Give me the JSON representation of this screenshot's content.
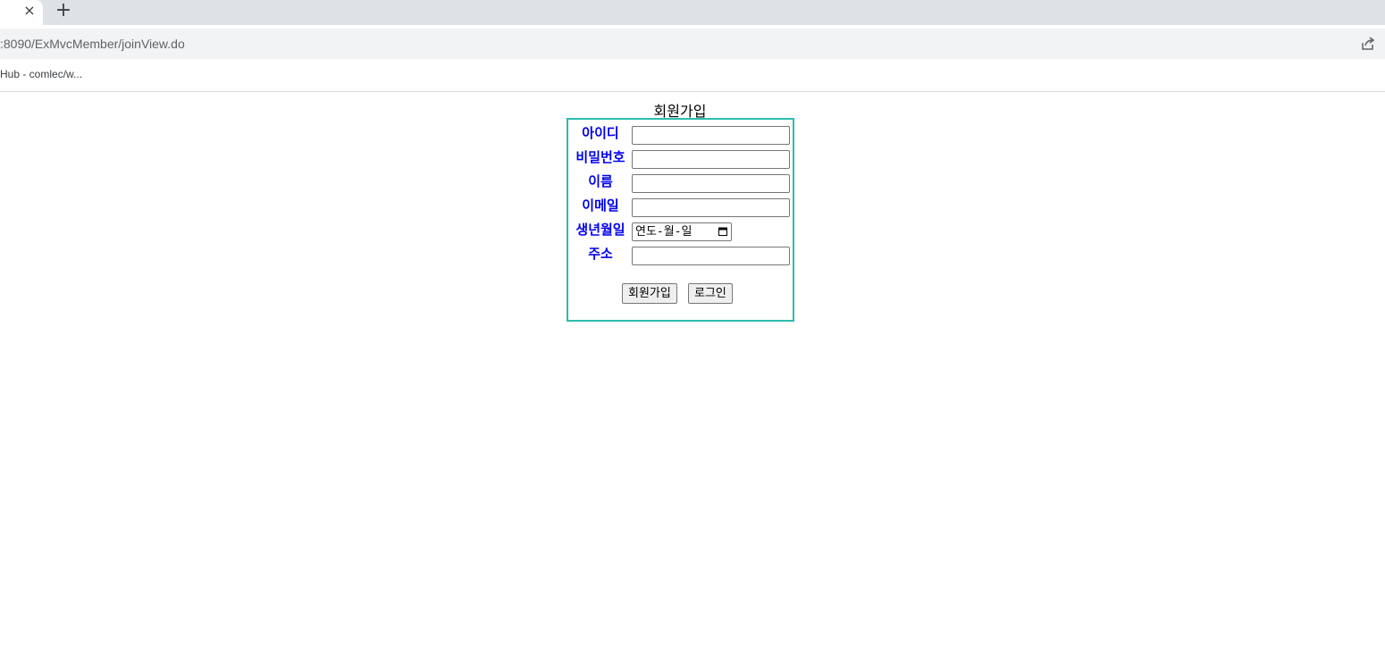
{
  "browser": {
    "tab_close_glyph": "×",
    "new_tab_glyph": "+",
    "url": ":8090/ExMvcMember/joinView.do",
    "bookmark": "Hub - comlec/w..."
  },
  "page": {
    "title": "회원가입"
  },
  "form": {
    "fields": [
      {
        "label": "아이디",
        "value": ""
      },
      {
        "label": "비밀번호",
        "value": ""
      },
      {
        "label": "이름",
        "value": ""
      },
      {
        "label": "이메일",
        "value": ""
      },
      {
        "label": "생년월일",
        "placeholder": "연도-월-일"
      },
      {
        "label": "주소",
        "value": ""
      }
    ],
    "submit_label": "회원가입",
    "login_label": "로그인",
    "border_color": "#2cbcb0",
    "label_color": "#0000ee"
  }
}
